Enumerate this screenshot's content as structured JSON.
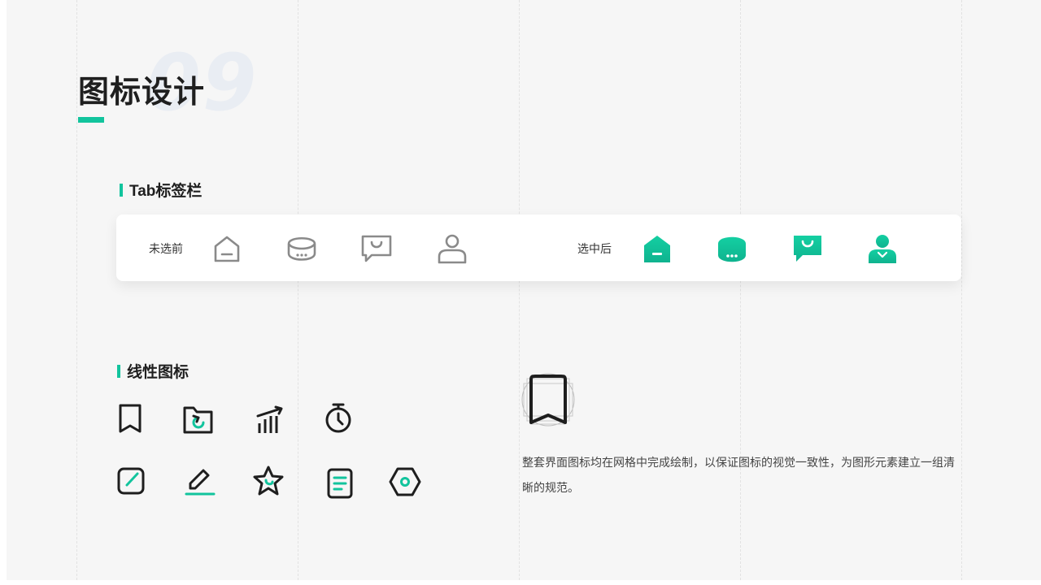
{
  "page": {
    "bg_number": "09",
    "title": "图标设计",
    "accent_color": "#12c49d"
  },
  "tab_section": {
    "heading": "Tab标签栏",
    "unselected_label": "未选前",
    "selected_label": "选中后",
    "unselected_icons": [
      "home-icon",
      "message-bubble-icon",
      "shopping-chat-icon",
      "user-icon"
    ],
    "selected_icons": [
      "home-filled-icon",
      "message-bubble-filled-icon",
      "shopping-chat-filled-icon",
      "user-filled-icon"
    ]
  },
  "linear_section": {
    "heading": "线性图标",
    "icons_row1": [
      "bookmark-icon",
      "folder-refresh-icon",
      "signal-chart-icon",
      "stopwatch-icon"
    ],
    "icons_row2": [
      "edit-square-icon",
      "pencil-icon",
      "star-icon",
      "document-icon",
      "hexagon-nut-icon"
    ]
  },
  "description": {
    "text": "整套界面图标均在网格中完成绘制，以保证图标的视觉一致性，为图形元素建立一组清晰的规范。"
  }
}
